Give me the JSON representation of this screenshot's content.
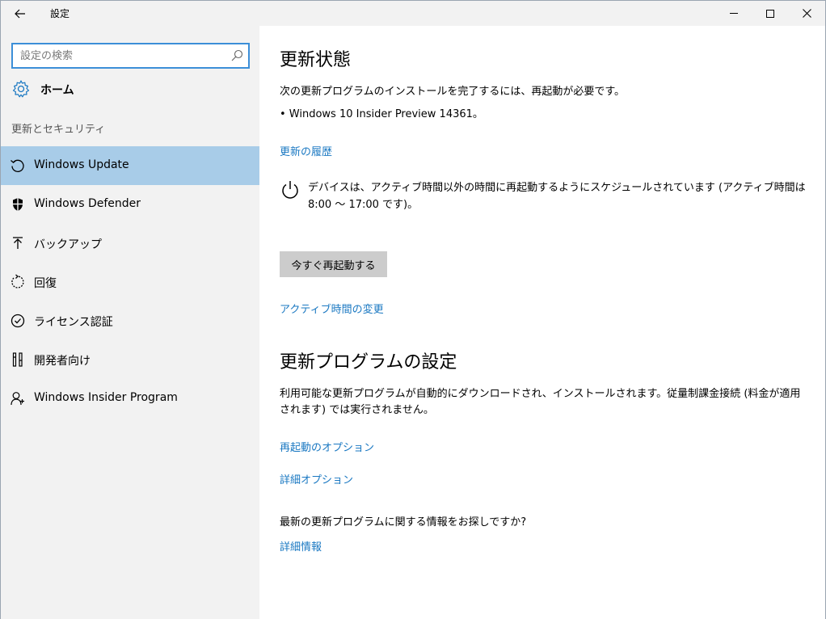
{
  "window": {
    "title": "設定",
    "back_icon": "back-arrow-icon",
    "controls": [
      "minimize",
      "maximize",
      "close"
    ]
  },
  "sidebar": {
    "search": {
      "placeholder": "設定の検索",
      "value": ""
    },
    "home": {
      "label": "ホーム",
      "icon": "gear-icon"
    },
    "section_label": "更新とセキュリティ",
    "items": [
      {
        "label": "Windows Update",
        "icon": "refresh-icon",
        "active": true
      },
      {
        "label": "Windows Defender",
        "icon": "shield-icon",
        "active": false
      },
      {
        "label": "バックアップ",
        "icon": "backup-arrow-icon",
        "active": false
      },
      {
        "label": "回復",
        "icon": "recovery-icon",
        "active": false
      },
      {
        "label": "ライセンス認証",
        "icon": "check-circle-icon",
        "active": false
      },
      {
        "label": "開発者向け",
        "icon": "developer-tools-icon",
        "active": false
      },
      {
        "label": "Windows Insider Program",
        "icon": "person-icon",
        "active": false
      }
    ]
  },
  "main": {
    "update_status": {
      "heading": "更新状態",
      "message": "次の更新プログラムのインストールを完了するには、再起動が必要です。",
      "pending_update": "• Windows 10 Insider Preview 14361。",
      "history_link": "更新の履歴",
      "schedule_text": "デバイスは、アクティブ時間以外の時間に再起動するようにスケジュールされています (アクティブ時間は 8:00 ～ 17:00 です)。",
      "restart_button": "今すぐ再起動する",
      "change_active_hours_link": "アクティブ時間の変更"
    },
    "update_settings": {
      "heading": "更新プログラムの設定",
      "description": "利用可能な更新プログラムが自動的にダウンロードされ、インストールされます。従量制課金接続 (料金が適用されます) では実行されません。",
      "restart_options_link": "再起動のオプション",
      "advanced_options_link": "詳細オプション"
    },
    "more_info": {
      "question": "最新の更新プログラムに関する情報をお探しですか?",
      "learn_more_link": "詳細情報"
    }
  },
  "colors": {
    "accent": "#1a78c2",
    "sidebar_bg": "#f2f2f2",
    "active_item_bg": "#a8cce8",
    "button_bg": "#cccccc"
  }
}
